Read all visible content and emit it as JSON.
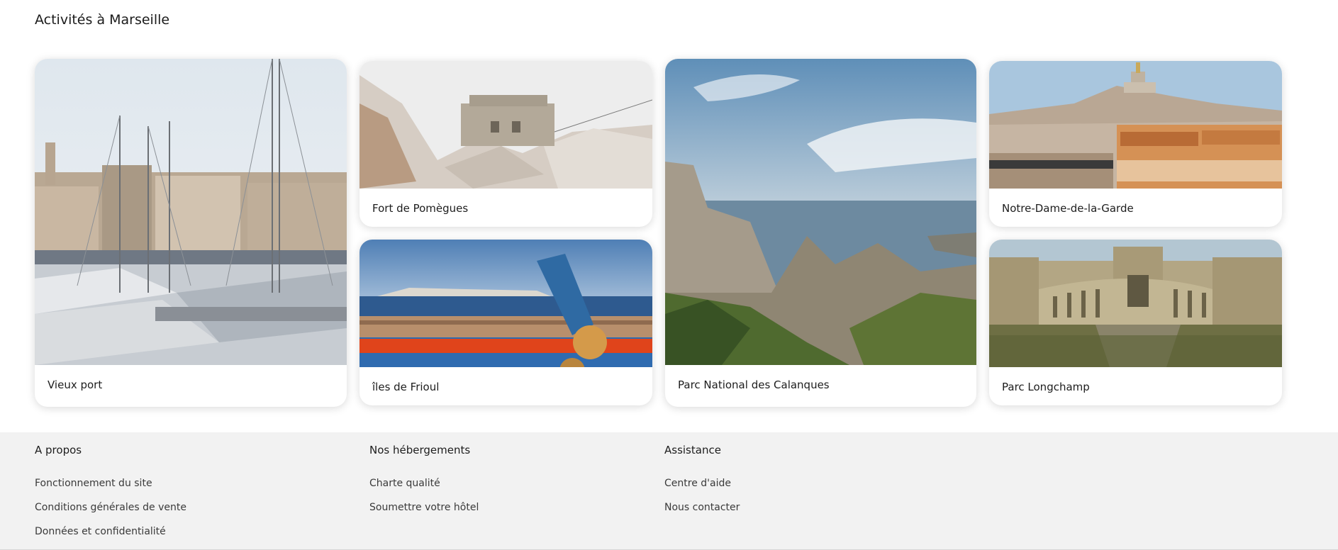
{
  "section": {
    "title": "Activités à Marseille"
  },
  "activities": [
    {
      "label": "Vieux port"
    },
    {
      "label": "Fort de Pomègues"
    },
    {
      "label": "îles de Frioul"
    },
    {
      "label": "Parc National des Calanques"
    },
    {
      "label": "Notre-Dame-de-la-Garde"
    },
    {
      "label": "Parc Longchamp"
    }
  ],
  "footer": {
    "columns": [
      {
        "heading": "A propos",
        "links": [
          "Fonctionnement du site",
          "Conditions générales de vente",
          "Données et confidentialité"
        ]
      },
      {
        "heading": "Nos hébergements",
        "links": [
          "Charte qualité",
          "Soumettre votre hôtel"
        ]
      },
      {
        "heading": "Assistance",
        "links": [
          "Centre d'aide",
          "Nous contacter"
        ]
      }
    ]
  }
}
